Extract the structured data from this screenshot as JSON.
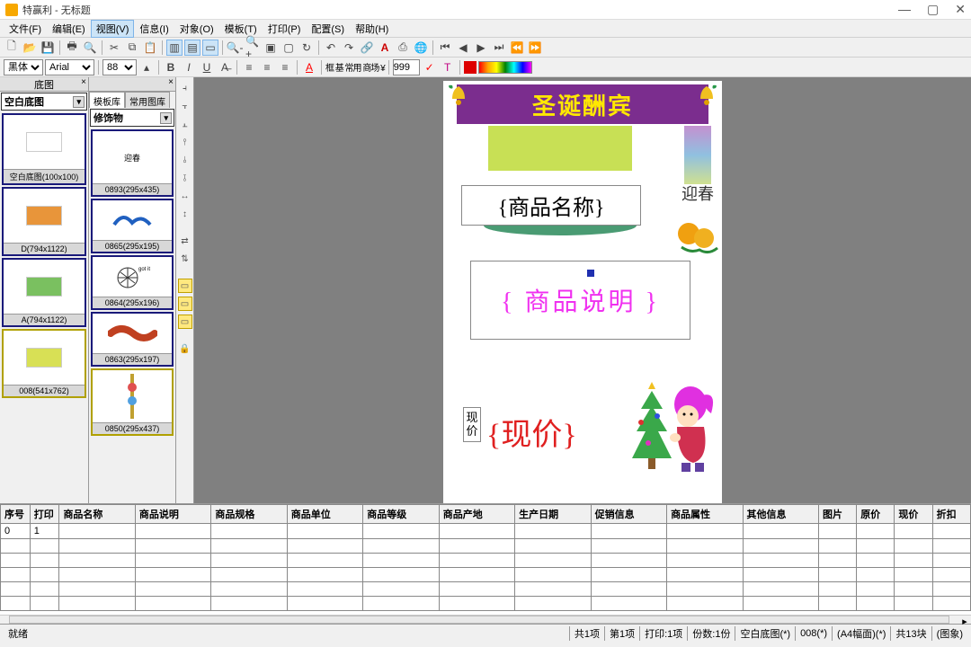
{
  "app": {
    "title": "特赢利 - 无标题"
  },
  "menu": [
    "文件(F)",
    "编辑(E)",
    "视图(V)",
    "信息(I)",
    "对象(O)",
    "模板(T)",
    "打印(P)",
    "配置(S)",
    "帮助(H)"
  ],
  "menu_active_index": 2,
  "format": {
    "font_style": "黑体",
    "font_family": "Arial",
    "font_size": "88",
    "sample": "999"
  },
  "left_panel": {
    "title": "底图",
    "combo": "空白底图",
    "items": [
      {
        "label": "空白底图(100x100)"
      },
      {
        "label": "D(794x1122)"
      },
      {
        "label": "A(794x1122)"
      },
      {
        "label": "008(541x762)"
      }
    ],
    "selected_index": 3
  },
  "mid_panel": {
    "tabs": [
      "模板库",
      "常用图库"
    ],
    "combo": "修饰物",
    "items": [
      {
        "label": "0893(295x435)"
      },
      {
        "label": "0865(295x195)"
      },
      {
        "label": "0864(295x196)"
      },
      {
        "label": "0863(295x197)"
      },
      {
        "label": "0850(295x437)"
      }
    ],
    "selected_index": 4
  },
  "canvas": {
    "banner_text": "圣诞酬宾",
    "side_text": "迎春",
    "field1": "{商品名称}",
    "field2": "{ 商品说明 }",
    "field3_label": "现价",
    "field3": "{现价}"
  },
  "grid": {
    "headers": [
      "序号",
      "打印",
      "商品名称",
      "商品说明",
      "商品规格",
      "商品单位",
      "商品等级",
      "商品产地",
      "生产日期",
      "促销信息",
      "商品属性",
      "其他信息",
      "图片",
      "原价",
      "现价",
      "折扣"
    ],
    "row0": {
      "c0": "0",
      "c1": "1"
    }
  },
  "status": {
    "ready": "就绪",
    "s1": "共1项",
    "s2": "第1项",
    "s3": "打印:1项",
    "s4": "份数:1份",
    "s5": "空白底图(*)",
    "s6": "008(*)",
    "s7": "(A4幅面)(*)",
    "s8": "共13块",
    "s9": "(图象)"
  }
}
